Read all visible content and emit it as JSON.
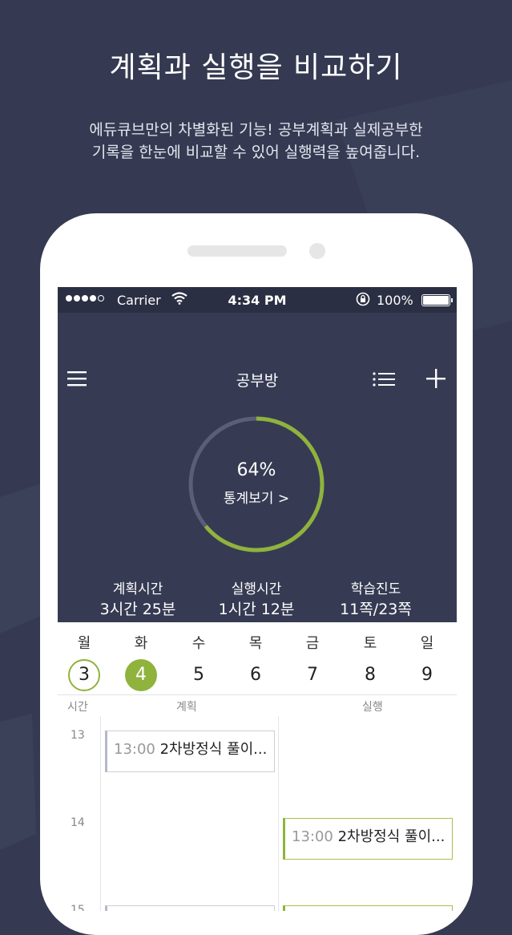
{
  "promo": {
    "headline": "계획과 실행을 비교하기",
    "subline_1": "에듀큐브만의 차별화된 기능! 공부계획과 실제공부한",
    "subline_2": "기록을 한눈에 비교할 수 있어 실행력을 높여줍니다."
  },
  "status_bar": {
    "carrier": "Carrier",
    "time": "4:34 PM",
    "battery": "100%"
  },
  "nav": {
    "title": "공부방",
    "menu_icon": "hamburger-menu-icon",
    "list_icon": "list-icon",
    "add_icon": "plus-icon"
  },
  "progress": {
    "percent": 64,
    "label": "64%",
    "link": "통계보기 >"
  },
  "stats": [
    {
      "label": "계획시간",
      "value": "3시간 25분"
    },
    {
      "label": "실행시간",
      "value": "1시간 12분"
    },
    {
      "label": "학습진도",
      "value": "11쪽/23쪽"
    }
  ],
  "week": [
    {
      "day": "월",
      "date": "3",
      "state": "outline"
    },
    {
      "day": "화",
      "date": "4",
      "state": "selected"
    },
    {
      "day": "수",
      "date": "5",
      "state": ""
    },
    {
      "day": "목",
      "date": "6",
      "state": ""
    },
    {
      "day": "금",
      "date": "7",
      "state": ""
    },
    {
      "day": "토",
      "date": "8",
      "state": ""
    },
    {
      "day": "일",
      "date": "9",
      "state": ""
    }
  ],
  "table": {
    "col_time": "시간",
    "col_plan": "계획",
    "col_exec": "실행"
  },
  "hours": [
    "13",
    "14",
    "15"
  ],
  "events": {
    "plan": [
      {
        "time": "13:00",
        "title": "2차방정식 풀이..."
      }
    ],
    "exec": [
      {
        "time": "13:00",
        "title": "2차방정식 풀이..."
      }
    ]
  },
  "colors": {
    "accent": "#8fb33c",
    "header_bg": "#363b53",
    "page_bg": "#353a52",
    "ring_track": "#5a5f77"
  }
}
